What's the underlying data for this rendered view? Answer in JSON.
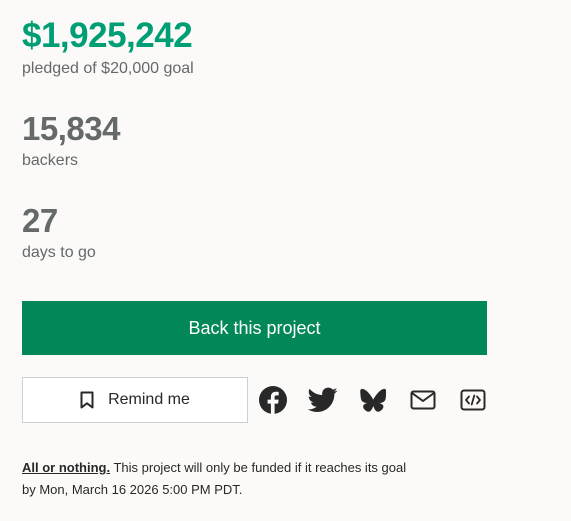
{
  "stats": {
    "pledged_amount": "$1,925,242",
    "pledged_label": "pledged of $20,000 goal",
    "backers_count": "15,834",
    "backers_label": "backers",
    "days_count": "27",
    "days_label": "days to go"
  },
  "actions": {
    "back_label": "Back this project",
    "remind_label": "Remind me"
  },
  "share": {
    "icons": [
      "facebook-icon",
      "twitter-icon",
      "bluesky-icon",
      "mail-icon",
      "embed-code-icon"
    ]
  },
  "funding": {
    "all_or_nothing": "All or nothing.",
    "line1_rest": " This project will only be funded if it reaches its goal",
    "line2": "by Mon, March 16 2026 5:00 PM PDT."
  },
  "colors": {
    "pledged_green": "#009e74",
    "button_green": "#028858",
    "stat_gray": "#656969",
    "icon_dark": "#282828"
  }
}
